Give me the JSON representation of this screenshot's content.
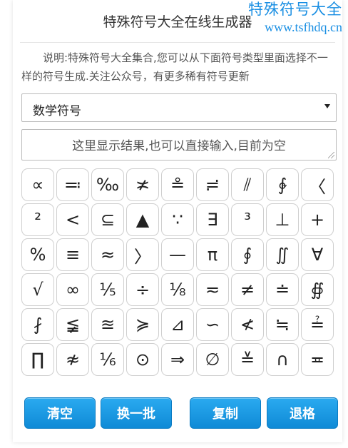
{
  "watermark": {
    "line1": "特殊符号大全",
    "line2": "www.tsfhdq.cn"
  },
  "header": {
    "title": "特殊符号大全在线生成器"
  },
  "description": "说明:特殊符号大全集合,您可以从下面符号类型里面选择不一样的符号生成.关注公众号，有更多稀有符号更新",
  "category_select": {
    "selected": "数学符号"
  },
  "result": {
    "placeholder": "这里显示结果,也可以直接输入,目前为空"
  },
  "symbols": [
    "∝",
    "≕",
    "‰",
    "≭",
    "≗",
    "≓",
    "⫽",
    "∲",
    "〈",
    "²",
    "<",
    "⊆",
    "▲",
    "∵",
    "∃",
    "³",
    "⊥",
    "+",
    "%",
    "≡",
    "≈",
    "〉",
    "—",
    "π",
    "∮",
    "∬",
    "∀",
    "√",
    "∞",
    "⅕",
    "÷",
    "⅛",
    "≂",
    "≠",
    "≐",
    "∯",
    "⨏",
    "≨",
    "≊",
    "≽",
    "⊿",
    "∽",
    "≮",
    "≒",
    "≟",
    "∏",
    "≉",
    "⅙",
    "⊙",
    "⇒",
    "∅",
    "≚",
    "∩",
    "≖"
  ],
  "buttons": {
    "clear": "清空",
    "refresh": "换一批",
    "copy": "复制",
    "backspace": "退格"
  }
}
